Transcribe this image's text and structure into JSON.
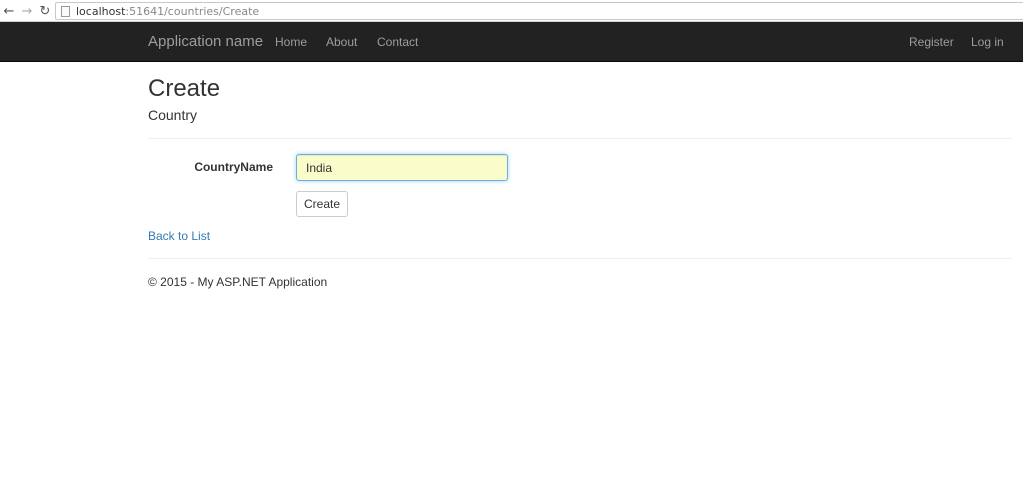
{
  "browser": {
    "url_host": "localhost",
    "url_path": ":51641/countries/Create",
    "back_icon": "arrow-left-icon",
    "forward_icon": "arrow-right-icon",
    "reload_icon": "reload-icon"
  },
  "navbar": {
    "brand": "Application name",
    "links": [
      "Home",
      "About",
      "Contact"
    ],
    "right_links": [
      "Register",
      "Log in"
    ],
    "background": "#222222",
    "link_color": "#9d9d9d"
  },
  "page": {
    "title": "Create",
    "subtitle": "Country"
  },
  "form": {
    "label": "CountryName",
    "value": "India",
    "submit_label": "Create"
  },
  "back_link": "Back to List",
  "footer": "© 2015 - My ASP.NET Application",
  "colors": {
    "link": "#337ab7",
    "input_bg": "#fafcc9",
    "input_focus_border": "#66afe9"
  }
}
